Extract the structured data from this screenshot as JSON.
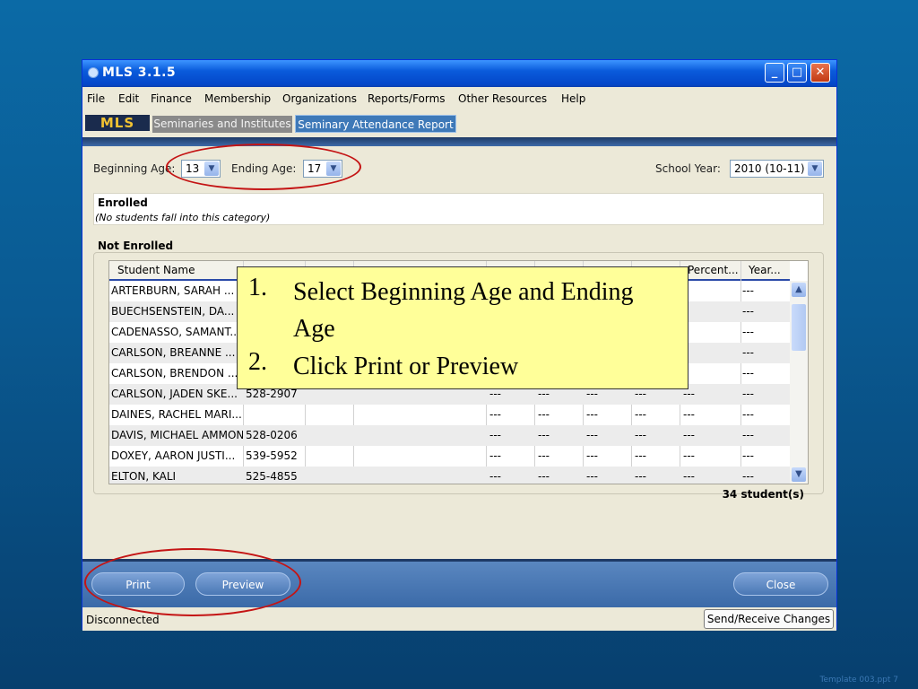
{
  "window": {
    "title": "MLS 3.1.5",
    "controls": {
      "minimize": "_",
      "maximize": "□",
      "close": "✕"
    }
  },
  "menu": [
    "File",
    "Edit",
    "Finance",
    "Membership",
    "Organizations",
    "Reports/Forms",
    "Other Resources",
    "Help"
  ],
  "tabs": {
    "logo": "MLS",
    "seminaries": "Seminaries and Institutes",
    "active": "Seminary Attendance Report"
  },
  "filters": {
    "beginning_age_label": "Beginning Age:",
    "beginning_age_value": "13",
    "ending_age_label": "Ending Age:",
    "ending_age_value": "17",
    "school_year_label": "School Year:",
    "school_year_value": "2010 (10-11)"
  },
  "enrolled": {
    "title": "Enrolled",
    "empty": "(No students fall into this category)"
  },
  "not_enrolled": {
    "title": "Not Enrolled",
    "headers": {
      "name": "Student Name",
      "percent": "Percent...",
      "year": "Year..."
    },
    "rows": [
      {
        "name": "ARTERBURN, SARAH ...",
        "id": "",
        "d1": "",
        "d2": "",
        "d3": "",
        "d4": "",
        "d5": "",
        "year": "---"
      },
      {
        "name": "BUECHSENSTEIN, DA...",
        "id": "",
        "d1": "",
        "d2": "",
        "d3": "",
        "d4": "",
        "d5": "",
        "year": "---"
      },
      {
        "name": "CADENASSO, SAMANT...",
        "id": "",
        "d1": "",
        "d2": "",
        "d3": "",
        "d4": "",
        "d5": "",
        "year": "---"
      },
      {
        "name": "CARLSON, BREANNE ...",
        "id": "",
        "d1": "",
        "d2": "",
        "d3": "",
        "d4": "",
        "d5": "",
        "year": "---"
      },
      {
        "name": "CARLSON, BRENDON ...",
        "id": "",
        "d1": "",
        "d2": "",
        "d3": "",
        "d4": "",
        "d5": "",
        "year": "---"
      },
      {
        "name": "CARLSON, JADEN SKE...",
        "id": "528-2907",
        "d1": "---",
        "d2": "---",
        "d3": "---",
        "d4": "---",
        "d5": "---",
        "year": "---"
      },
      {
        "name": "DAINES, RACHEL MARI...",
        "id": "",
        "d1": "---",
        "d2": "---",
        "d3": "---",
        "d4": "---",
        "d5": "---",
        "year": "---"
      },
      {
        "name": "DAVIS, MICHAEL AMMON",
        "id": "528-0206",
        "d1": "---",
        "d2": "---",
        "d3": "---",
        "d4": "---",
        "d5": "---",
        "year": "---"
      },
      {
        "name": "DOXEY, AARON JUSTI...",
        "id": "539-5952",
        "d1": "---",
        "d2": "---",
        "d3": "---",
        "d4": "---",
        "d5": "---",
        "year": "---"
      },
      {
        "name": "ELTON, KALI",
        "id": "525-4855",
        "d1": "---",
        "d2": "---",
        "d3": "---",
        "d4": "---",
        "d5": "---",
        "year": "---"
      }
    ],
    "count": "34 student(s)"
  },
  "buttons": {
    "print": "Print",
    "preview": "Preview",
    "close": "Close"
  },
  "status": {
    "connection": "Disconnected",
    "send_receive": "Send/Receive Changes"
  },
  "callout": [
    {
      "num": "1.",
      "text": "Select Beginning Age and Ending Age"
    },
    {
      "num": "2.",
      "text": "Click Print or Preview"
    }
  ],
  "footer": "Template 003.ppt  7",
  "colors": {
    "highlight_ring": "#c41414",
    "callout_bg": "#ffff99"
  }
}
